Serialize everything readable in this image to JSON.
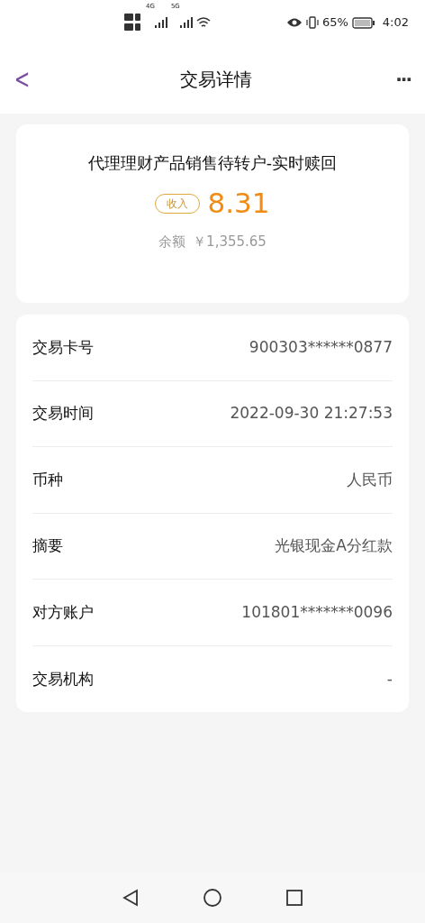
{
  "status_bar": {
    "network_1": "4G",
    "network_2": "5G",
    "battery": "65%",
    "time": "4:02"
  },
  "header": {
    "title": "交易详情",
    "back": "<",
    "more": "···"
  },
  "summary": {
    "title": "代理理财产品销售待转户-实时赎回",
    "tag": "收入",
    "amount": "8.31",
    "balance_label": "余额",
    "balance": "￥1,355.65"
  },
  "details": [
    {
      "label": "交易卡号",
      "value": "900303******0877"
    },
    {
      "label": "交易时间",
      "value": "2022-09-30 21:27:53"
    },
    {
      "label": "币种",
      "value": "人民币"
    },
    {
      "label": "摘要",
      "value": "光银现金A分红款"
    },
    {
      "label": "对方账户",
      "value": "101801*******0096"
    },
    {
      "label": "交易机构",
      "value": "-"
    }
  ]
}
